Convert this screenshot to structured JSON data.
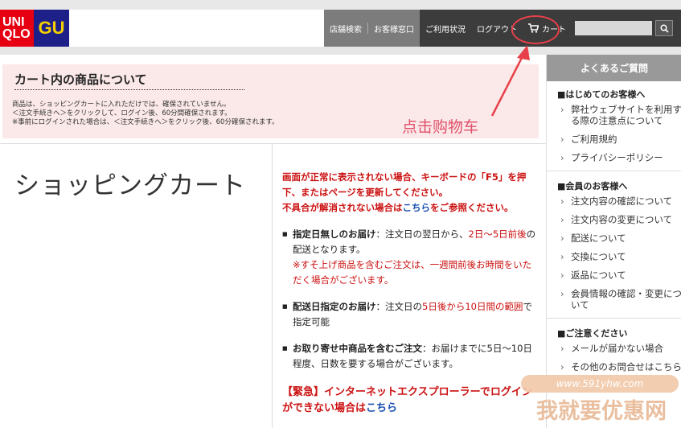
{
  "logo": {
    "uq_line1": "UNI",
    "uq_line2": "QLO",
    "gu": "GU"
  },
  "nav": {
    "store_search": "店舗検索",
    "customer_service": "お客様窓口",
    "usage_status": "ご利用状況",
    "logout": "ログアウト",
    "cart": "カート"
  },
  "search": {
    "placeholder": ""
  },
  "notice": {
    "title": "カート内の商品について",
    "line1": "商品は、ショッピングカートに入れただけでは、確保されていません。",
    "line2": "＜注文手続きへ＞をクリックして、ログイン後、60分間確保されます。",
    "line3": "※事前にログインされた場合は、＜注文手続きへ＞をクリック後、60分確保されます。"
  },
  "annotation": "点击购物车",
  "page_title": "ショッピングカート",
  "warning": {
    "line1": "画面が正常に表示されない場合、キーボードの「F5」を押下、またはページを更新してください。",
    "line2_pre": "不具合が解消されない場合は",
    "line2_link": "こちら",
    "line2_post": "をご参照ください。"
  },
  "bullets": [
    {
      "head": "指定日無しのお届け",
      "text_pre": "：注文日の翌日から、",
      "text_red": "2日～5日前後",
      "text_post": "の配送となります。",
      "note": "※すそ上げ商品を含むご注文は、一週間前後お時間をいただく場合がございます。"
    },
    {
      "head": "配送日指定のお届け",
      "text_pre": "：注文日の",
      "text_red": "5日後から10日間の範囲",
      "text_post": "で指定可能"
    },
    {
      "head": "お取り寄せ中商品を含むご注文",
      "text_pre": "：お届けまでに5日～10日程度、日数を要する場合がございます。"
    }
  ],
  "urgent": {
    "text": "【緊急】インターネットエクスプローラーでログインができない場合は",
    "link": "こちら"
  },
  "sidebar": {
    "header": "よくあるご質問",
    "sections": [
      {
        "title": "■はじめてのお客様へ",
        "items": [
          "弊社ウェブサイトを利用する際の注意点について",
          "ご利用規約",
          "プライバシーポリシー"
        ]
      },
      {
        "title": "■会員のお客様へ",
        "items": [
          "注文内容の確認について",
          "注文内容の変更について",
          "配送について",
          "交換について",
          "返品について",
          "会員情報の確認・変更について"
        ]
      },
      {
        "title": "■ご注意ください",
        "items": [
          "メールが届かない場合",
          "その他のお問合せはこちら"
        ]
      }
    ]
  },
  "watermark": {
    "url": "www.591yhw.com",
    "text": "我就要优惠网"
  },
  "colors": {
    "accent_red": "#cc1111",
    "uniqlo_red": "#e60012",
    "gu_blue": "#1d2088",
    "annotation": "#e8404a"
  }
}
